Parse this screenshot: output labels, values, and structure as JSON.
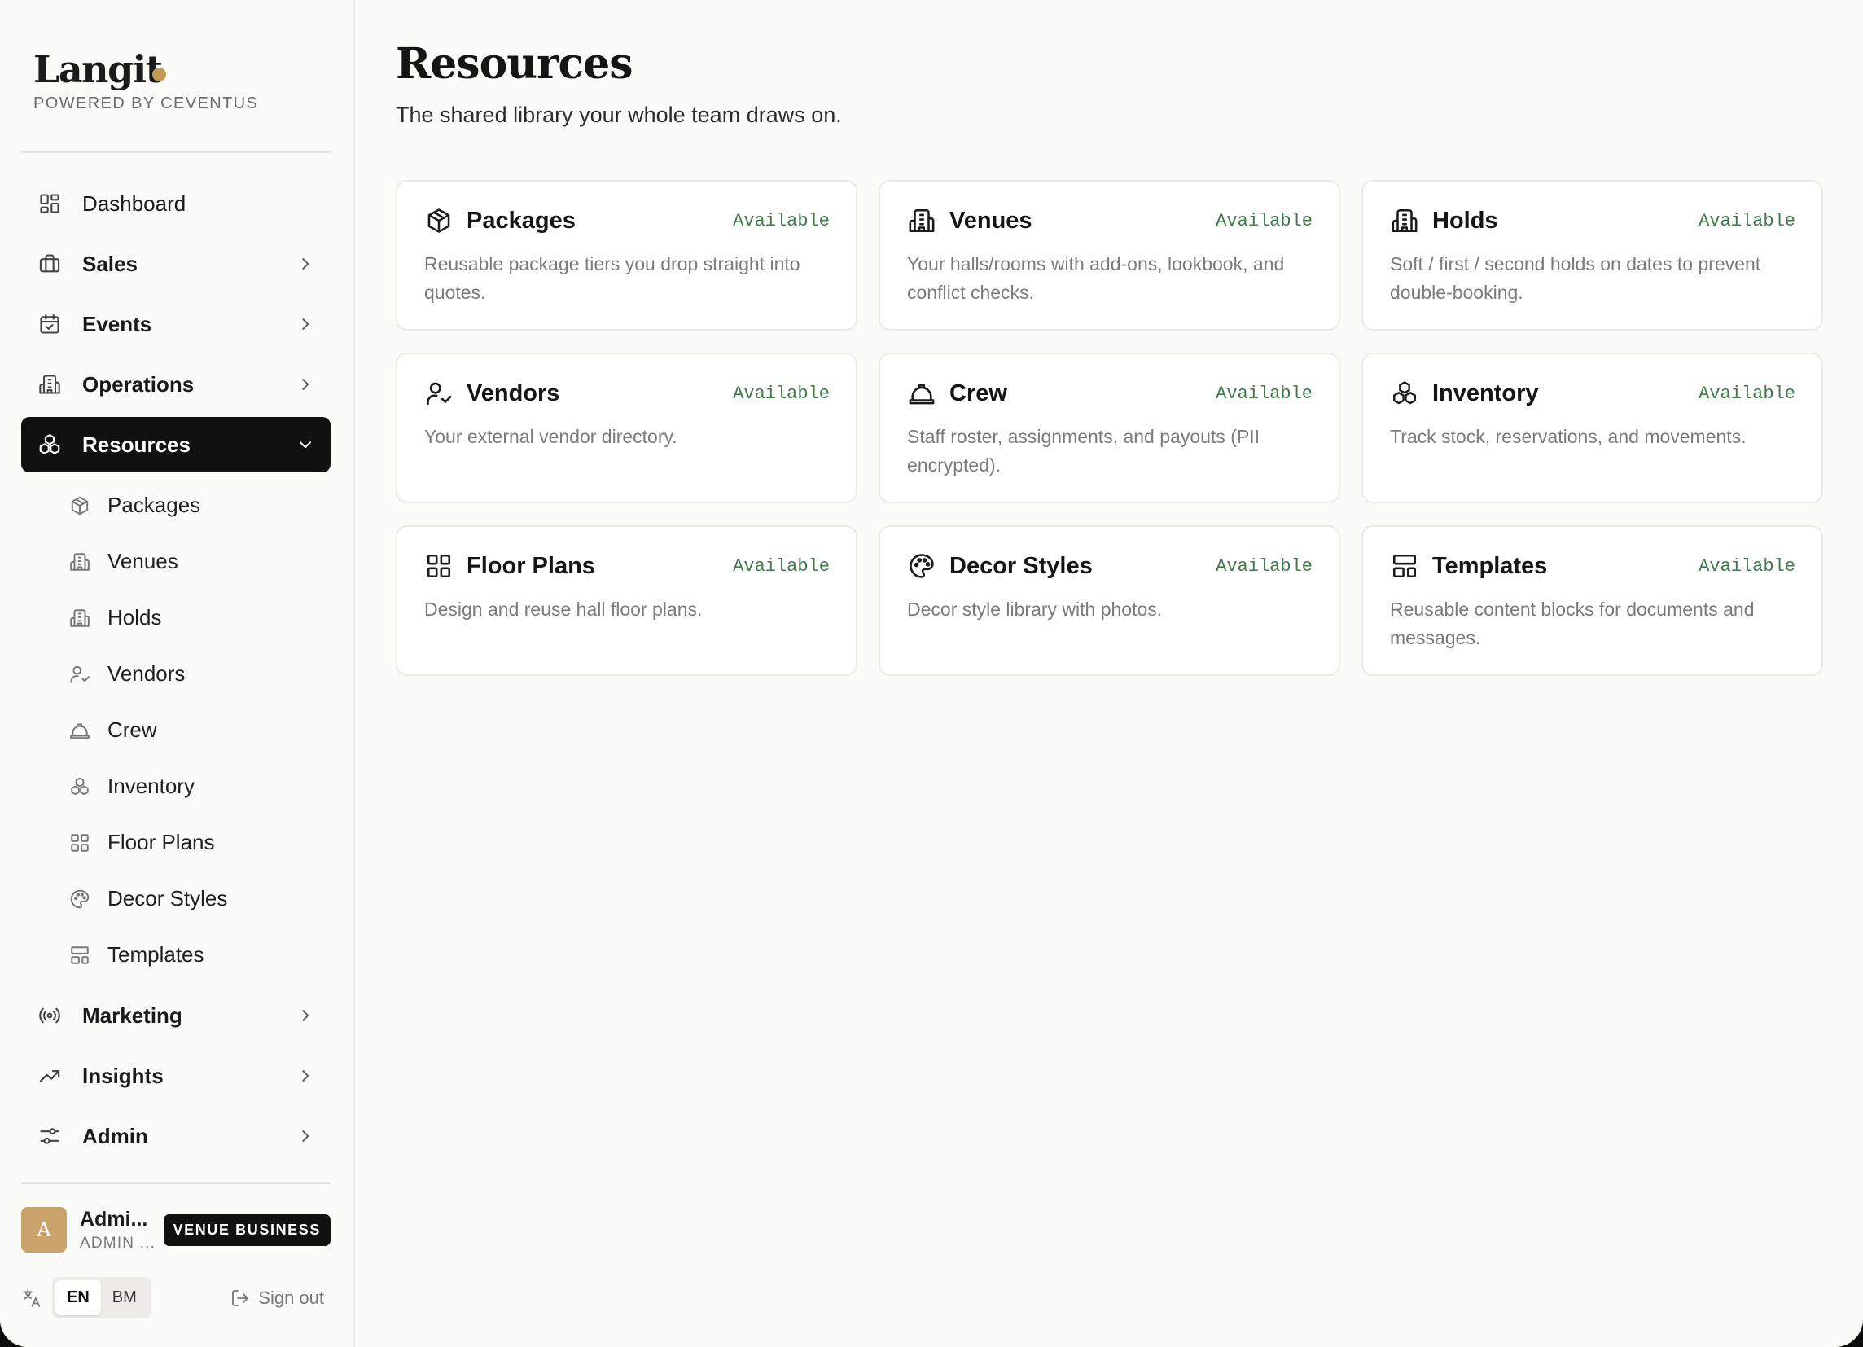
{
  "brand": {
    "name": "Langit",
    "powered_by": "POWERED BY CEVENTUS",
    "dot_color": "#c19a55"
  },
  "nav": {
    "dashboard": {
      "label": "Dashboard",
      "icon": "dashboard-icon"
    },
    "sales": {
      "label": "Sales",
      "icon": "briefcase-icon"
    },
    "events": {
      "label": "Events",
      "icon": "calendar-check-icon"
    },
    "operations": {
      "label": "Operations",
      "icon": "building-icon"
    },
    "resources": {
      "label": "Resources",
      "icon": "boxes-icon",
      "expanded": true,
      "items": [
        {
          "label": "Packages",
          "icon": "package-icon"
        },
        {
          "label": "Venues",
          "icon": "building-icon"
        },
        {
          "label": "Holds",
          "icon": "building-icon"
        },
        {
          "label": "Vendors",
          "icon": "user-check-icon"
        },
        {
          "label": "Crew",
          "icon": "hard-hat-icon"
        },
        {
          "label": "Inventory",
          "icon": "boxes-icon"
        },
        {
          "label": "Floor Plans",
          "icon": "grid-icon"
        },
        {
          "label": "Decor Styles",
          "icon": "palette-icon"
        },
        {
          "label": "Templates",
          "icon": "layout-template-icon"
        }
      ]
    },
    "marketing": {
      "label": "Marketing",
      "icon": "radio-icon"
    },
    "insights": {
      "label": "Insights",
      "icon": "trending-up-icon"
    },
    "admin": {
      "label": "Admin",
      "icon": "sliders-icon"
    }
  },
  "user": {
    "initial": "A",
    "name": "Admi...",
    "role": "ADMIN ...",
    "badge": "VENUE BUSINESS",
    "avatar_color": "#c9a36a"
  },
  "footer": {
    "lang_icon": "translate-icon",
    "languages": [
      "EN",
      "BM"
    ],
    "active_language": "EN",
    "signout": "Sign out"
  },
  "page": {
    "title": "Resources",
    "subtitle": "The shared library your whole team draws on."
  },
  "cards": [
    {
      "title": "Packages",
      "status": "Available",
      "icon": "package-icon",
      "description": "Reusable package tiers you drop straight into quotes."
    },
    {
      "title": "Venues",
      "status": "Available",
      "icon": "building-icon",
      "description": "Your halls/rooms with add-ons, lookbook, and conflict checks."
    },
    {
      "title": "Holds",
      "status": "Available",
      "icon": "building-icon",
      "description": "Soft / first / second holds on dates to prevent double-booking."
    },
    {
      "title": "Vendors",
      "status": "Available",
      "icon": "user-check-icon",
      "description": "Your external vendor directory."
    },
    {
      "title": "Crew",
      "status": "Available",
      "icon": "hard-hat-icon",
      "description": "Staff roster, assignments, and payouts (PII encrypted)."
    },
    {
      "title": "Inventory",
      "status": "Available",
      "icon": "boxes-icon",
      "description": "Track stock, reservations, and movements."
    },
    {
      "title": "Floor Plans",
      "status": "Available",
      "icon": "grid-icon",
      "description": "Design and reuse hall floor plans."
    },
    {
      "title": "Decor Styles",
      "status": "Available",
      "icon": "palette-icon",
      "description": "Decor style library with photos."
    },
    {
      "title": "Templates",
      "status": "Available",
      "icon": "layout-template-icon",
      "description": "Reusable content blocks for documents and messages."
    }
  ],
  "colors": {
    "active_nav": "#111111",
    "status": "#3f7a4a",
    "background": "#fafaf7"
  }
}
